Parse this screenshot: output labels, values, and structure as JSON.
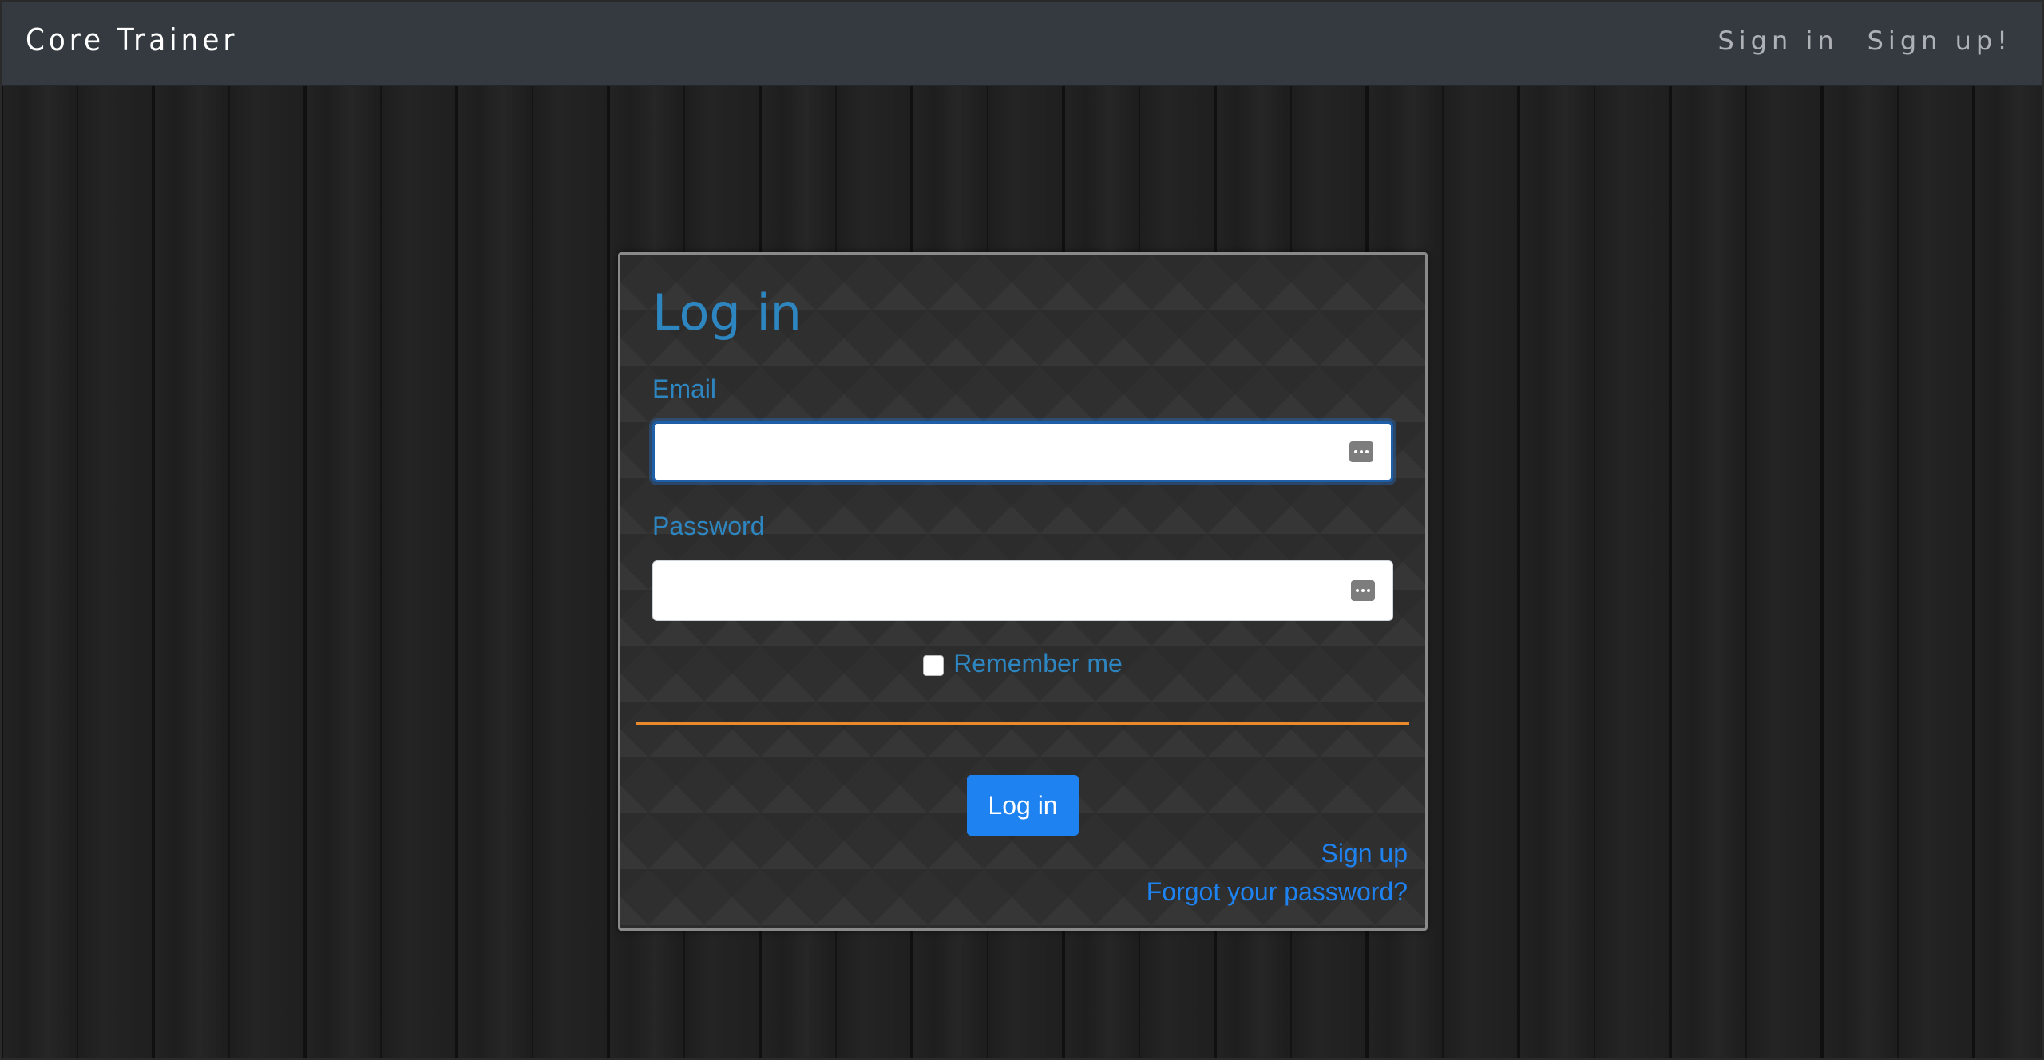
{
  "navbar": {
    "brand": "Core Trainer",
    "links": [
      "Sign in",
      "Sign up!"
    ]
  },
  "form": {
    "title": "Log in",
    "email": {
      "label": "Email",
      "value": "",
      "placeholder": ""
    },
    "password": {
      "label": "Password",
      "value": "",
      "placeholder": ""
    },
    "remember_label": "Remember me",
    "remember_checked": false,
    "submit_label": "Log in",
    "signup_link": "Sign up",
    "forgot_link": "Forgot your password?",
    "field_icon": "password-manager-icon"
  },
  "colors": {
    "navbar_bg": "#343a40",
    "title": "#2e86c1",
    "accent_divider": "#e8892b",
    "primary_button": "#1e82f0",
    "link": "#1e82f0"
  }
}
